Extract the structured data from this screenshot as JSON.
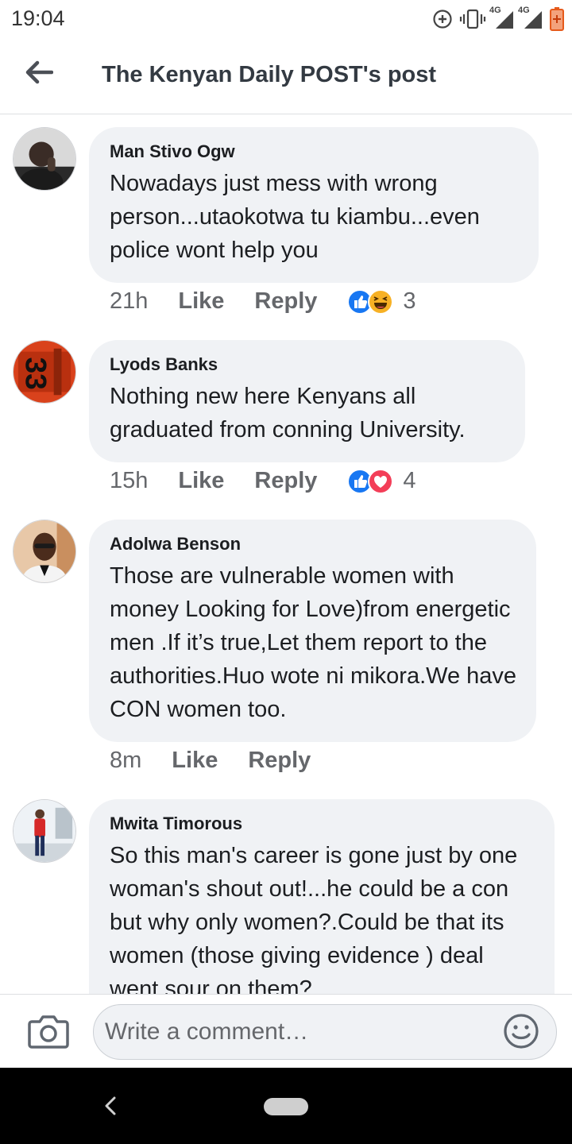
{
  "status_bar": {
    "time": "19:04",
    "icons": [
      "data-saver-icon",
      "vibrate-icon",
      "signal-4g-icon",
      "signal-4g-icon",
      "battery-low-icon"
    ],
    "network_label_1": "4G",
    "network_label_2": "4G"
  },
  "header": {
    "back_icon": "arrow-left-icon",
    "title": "The Kenyan Daily POST's post"
  },
  "comments": [
    {
      "author": "Man Stivo Ogw",
      "text": "Nowadays just mess with wrong person...utaokotwa tu kiambu...even police wont help you",
      "time": "21h",
      "like_label": "Like",
      "reply_label": "Reply",
      "reactions": [
        "like",
        "haha"
      ],
      "reaction_count": "3"
    },
    {
      "author": "Lyods Banks",
      "text": "Nothing new here Kenyans all graduated from conning University.",
      "time": "15h",
      "like_label": "Like",
      "reply_label": "Reply",
      "reactions": [
        "like",
        "love"
      ],
      "reaction_count": "4"
    },
    {
      "author": "Adolwa Benson",
      "text": "Those are vulnerable women with money Looking for Love)from energetic men .If it’s true,Let them report to the authorities.Huo wote ni mikora.We have CON women too.",
      "time": "8m",
      "like_label": "Like",
      "reply_label": "Reply",
      "reactions": [],
      "reaction_count": ""
    },
    {
      "author": "Mwita Timorous",
      "text": "So this man's career is gone just by one woman's shout out!...he could be a con but why only women?.Could be that its women (those giving evidence ) deal went sour on them?",
      "time": "",
      "like_label": "",
      "reply_label": "",
      "reactions": [],
      "reaction_count": ""
    }
  ],
  "composer": {
    "placeholder": "Write a comment…",
    "camera_icon": "camera-icon",
    "emoji_icon": "smiley-icon"
  },
  "nav_bar": {
    "back_icon": "chevron-left-icon",
    "home_icon": "home-pill-icon"
  },
  "colors": {
    "bubble_bg": "#f0f2f5",
    "like_blue": "#1877f2",
    "love_red": "#f33e58",
    "haha_yellow": "#f7b125",
    "meta_gray": "#65676b"
  }
}
